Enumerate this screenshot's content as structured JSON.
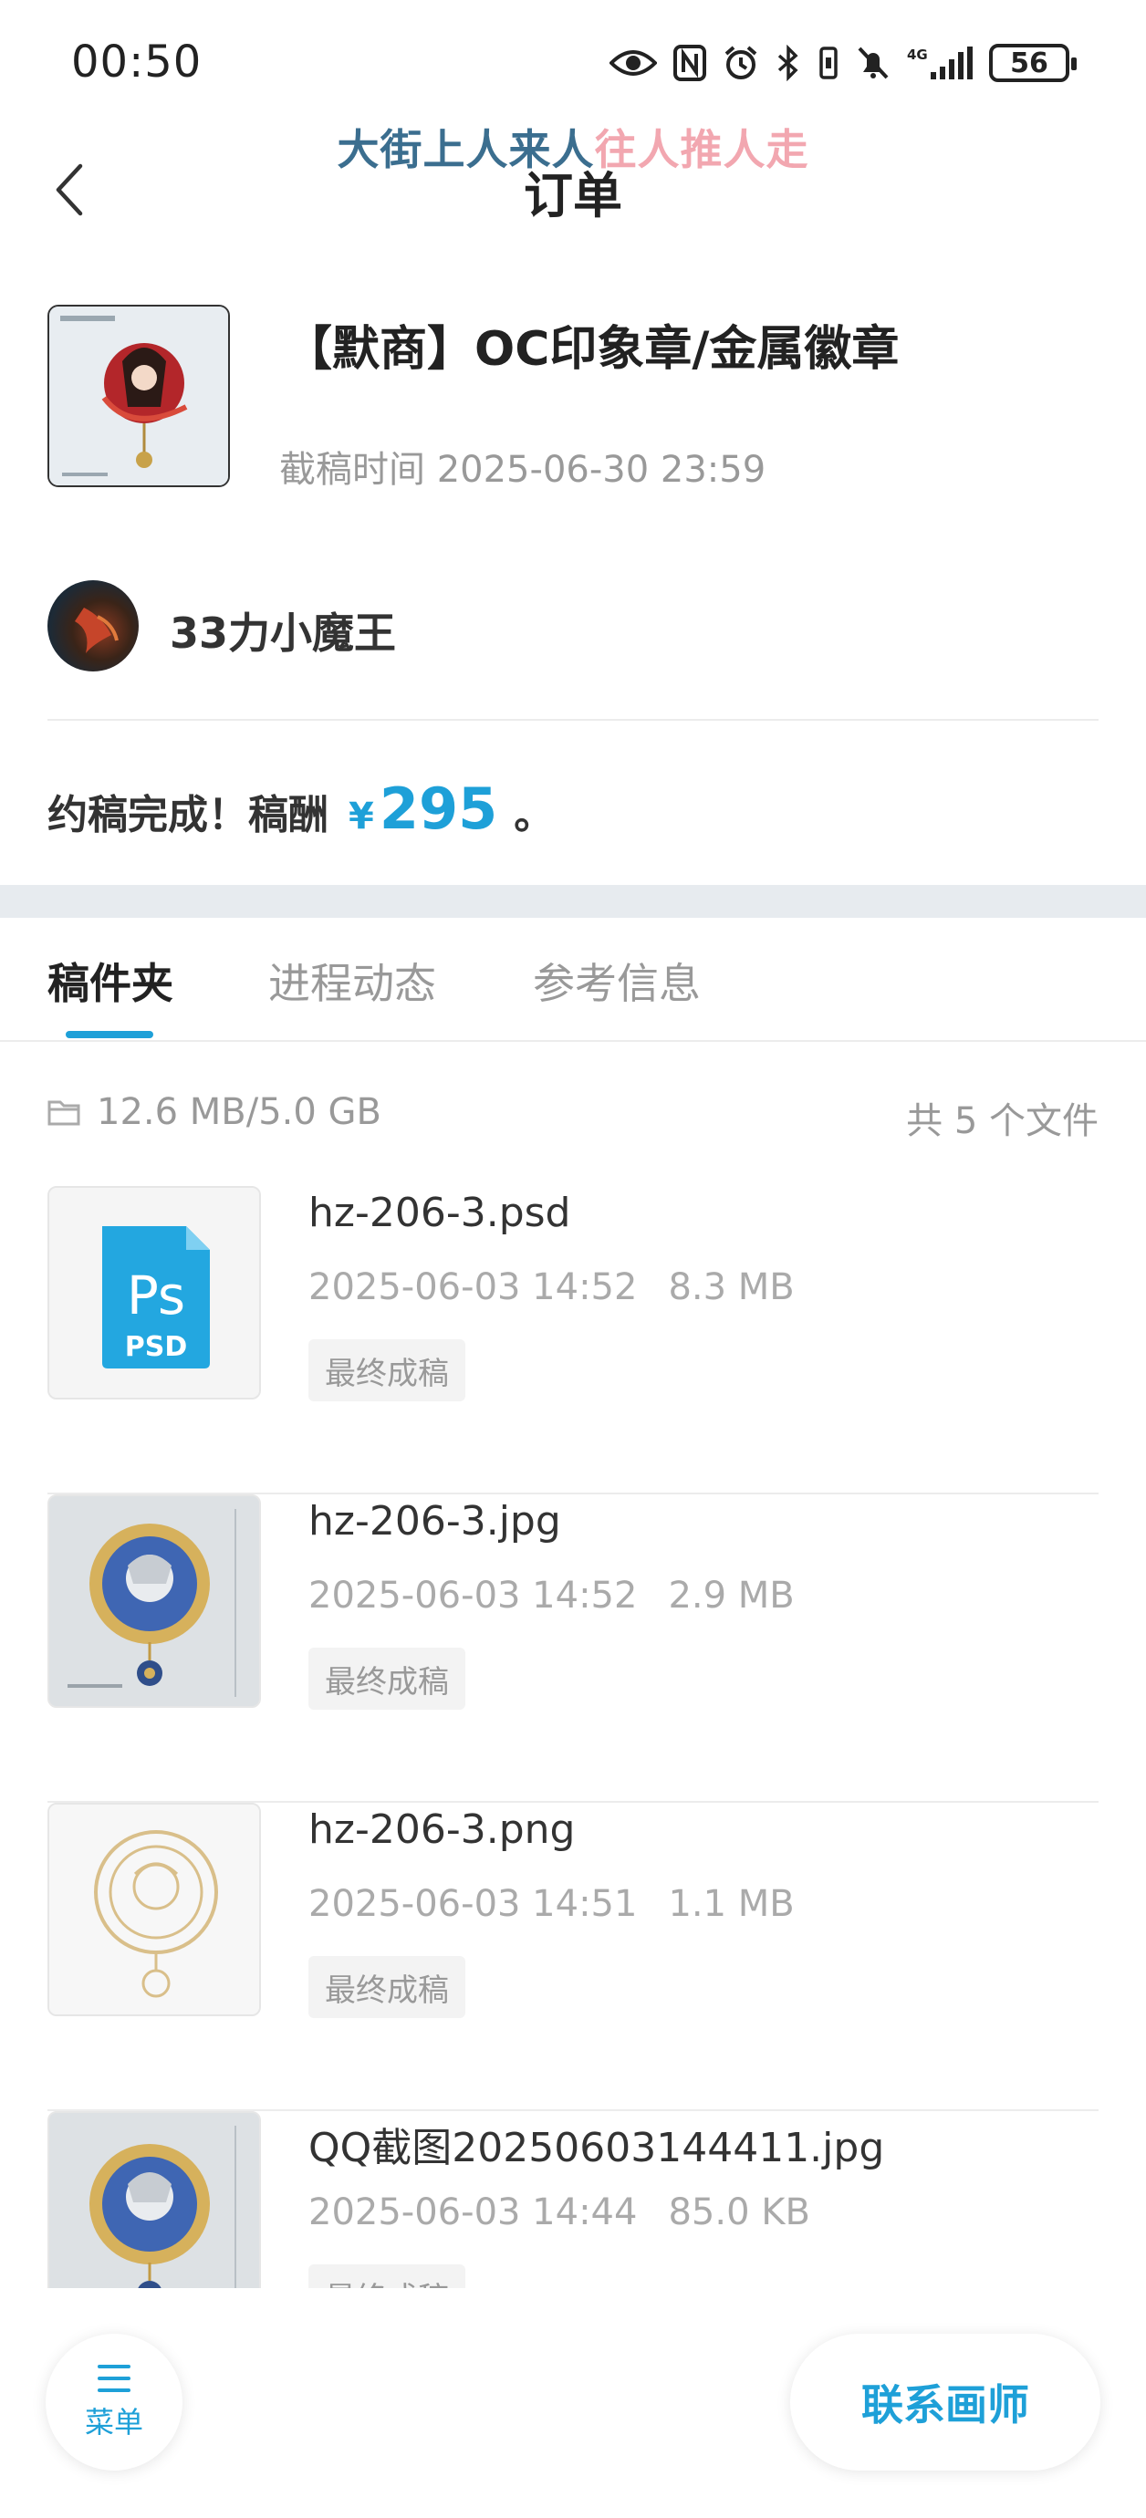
{
  "status_bar": {
    "time": "00:50",
    "network": "4G",
    "battery": "56"
  },
  "lyric": {
    "part_a": "大街上人来人",
    "part_b": "往人推人走"
  },
  "header": {
    "title": "订单"
  },
  "product": {
    "title": "【默商】OC印象章/金属徽章",
    "deadline": "截稿时间 2025-06-30 23:59"
  },
  "artist": {
    "name": "33力小魔王"
  },
  "completion": {
    "text": "约稿完成！稿酬",
    "currency": "¥",
    "amount": "295",
    "suffix": "。"
  },
  "tabs": [
    {
      "label": "稿件夹",
      "active": true
    },
    {
      "label": "进程动态",
      "active": false
    },
    {
      "label": "参考信息",
      "active": false
    }
  ],
  "storage": {
    "usage": "12.6 MB/5.0 GB",
    "file_count": "共 5 个文件"
  },
  "files": [
    {
      "name": "hz-206-3.psd",
      "date": "2025-06-03 14:52",
      "size": "8.3 MB",
      "tag": "最终成稿",
      "thumb": "psd-icon"
    },
    {
      "name": "hz-206-3.jpg",
      "date": "2025-06-03 14:52",
      "size": "2.9 MB",
      "tag": "最终成稿",
      "thumb": "artwork-color"
    },
    {
      "name": "hz-206-3.png",
      "date": "2025-06-03 14:51",
      "size": "1.1 MB",
      "tag": "最终成稿",
      "thumb": "artwork-line"
    },
    {
      "name": "QQ截图20250603144411.jpg",
      "date": "2025-06-03 14:44",
      "size": "85.0 KB",
      "tag": "最终成稿",
      "thumb": "artwork-color"
    }
  ],
  "bottom": {
    "menu_label": "菜单",
    "contact_label": "联系画师"
  },
  "colors": {
    "accent": "#1ea0d8",
    "lyric_a": "#3b6e8f",
    "lyric_b": "#f2a7b0"
  }
}
